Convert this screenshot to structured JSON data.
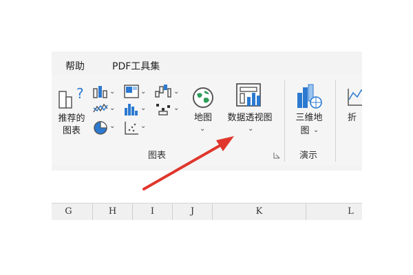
{
  "tabs": {
    "help": "帮助",
    "pdf_tools": "PDF工具集"
  },
  "charts_group": {
    "recommended_charts_line1": "推荐的",
    "recommended_charts_line2": "图表",
    "maps": "地图",
    "pivot_chart": "数据透视图",
    "group_label": "图表"
  },
  "tours_group": {
    "map_3d_line1": "三维地",
    "map_3d_line2": "图",
    "group_label": "演示"
  },
  "sparklines_group": {
    "line_partial": "折"
  },
  "columns": [
    "G",
    "H",
    "I",
    "J",
    "K",
    "L"
  ],
  "colors": {
    "accent_blue": "#2b79d0",
    "arrow_red": "#e0362c",
    "ribbon_bg": "#f5f5f5"
  }
}
